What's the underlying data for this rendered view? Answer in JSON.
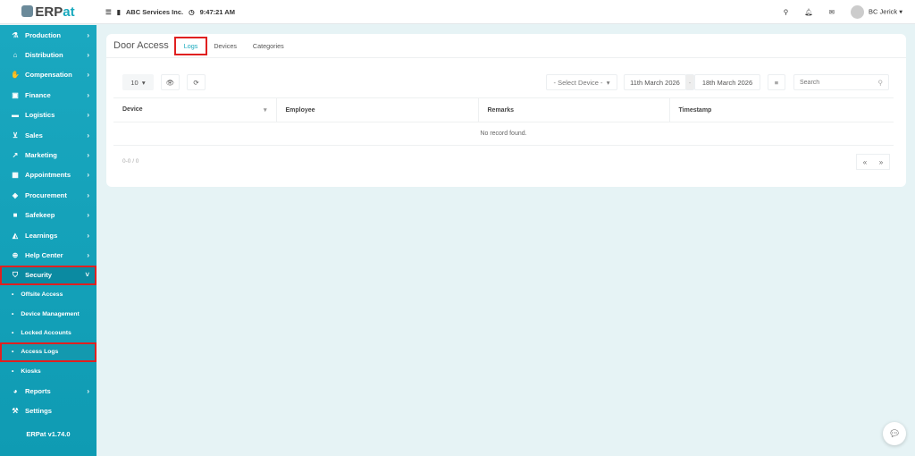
{
  "app": {
    "logo": "ERPat",
    "version": "ERPat v1.74.0"
  },
  "topbar": {
    "company": "ABC Services Inc.",
    "time": "9:47:21 AM",
    "user": "BC Jerick"
  },
  "sidebar": {
    "items": [
      {
        "label": "Production",
        "icon": "flask-icon"
      },
      {
        "label": "Distribution",
        "icon": "bank-icon"
      },
      {
        "label": "Compensation",
        "icon": "handshake-icon"
      },
      {
        "label": "Finance",
        "icon": "money-icon"
      },
      {
        "label": "Logistics",
        "icon": "truck-icon"
      },
      {
        "label": "Sales",
        "icon": "cart-icon"
      },
      {
        "label": "Marketing",
        "icon": "chart-icon"
      },
      {
        "label": "Appointments",
        "icon": "calendar-icon"
      },
      {
        "label": "Procurement",
        "icon": "cubes-icon"
      },
      {
        "label": "Safekeep",
        "icon": "box-icon"
      },
      {
        "label": "Learnings",
        "icon": "graduation-icon"
      },
      {
        "label": "Help Center",
        "icon": "lifebuoy-icon"
      },
      {
        "label": "Security",
        "icon": "shield-icon"
      }
    ],
    "security_sub": [
      "Offsite Access",
      "Device Management",
      "Locked Accounts",
      "Access Logs",
      "Kiosks"
    ],
    "bottom": [
      {
        "label": "Reports",
        "icon": "pie-icon"
      },
      {
        "label": "Settings",
        "icon": "wrench-icon"
      }
    ]
  },
  "page": {
    "title": "Door Access",
    "tabs": [
      "Logs",
      "Devices",
      "Categories"
    ]
  },
  "toolbar": {
    "page_size": "10",
    "device_select": "- Select Device -",
    "date_from": "11th March 2026",
    "date_sep": "-",
    "date_to": "18th March 2026",
    "search_placeholder": "Search"
  },
  "table": {
    "columns": [
      "Device",
      "Employee",
      "Remarks",
      "Timestamp"
    ],
    "empty": "No record found.",
    "count": "0-0 / 0"
  },
  "pager": {
    "prev": "«",
    "next": "»"
  }
}
